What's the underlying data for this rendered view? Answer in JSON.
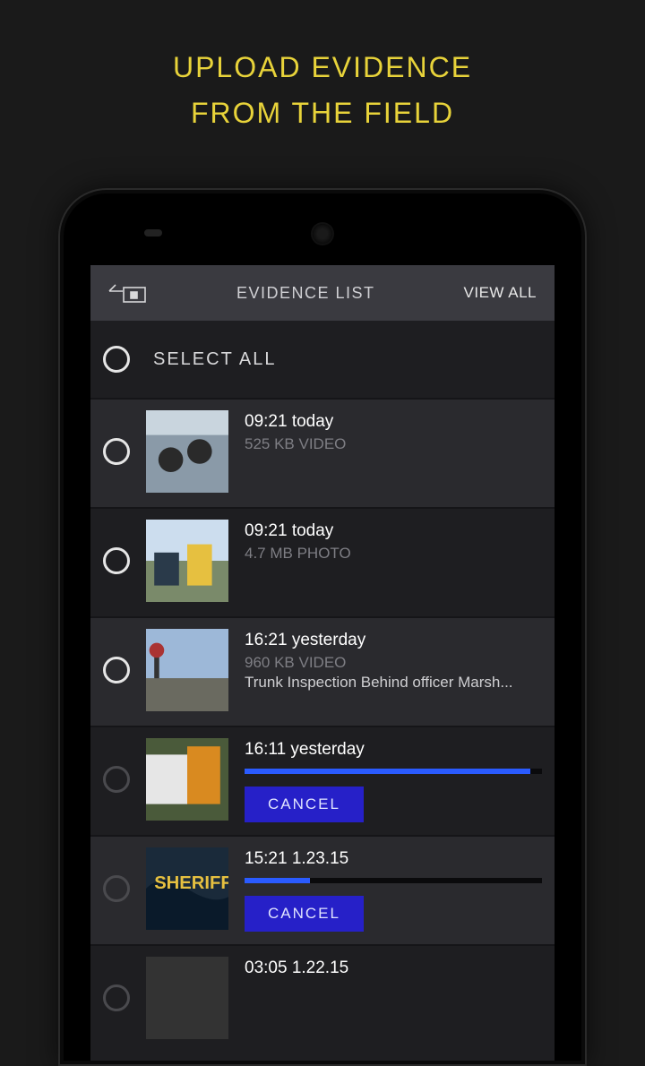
{
  "promo": {
    "line1": "UPLOAD EVIDENCE",
    "line2": "FROM THE FIELD"
  },
  "header": {
    "title": "EVIDENCE LIST",
    "view_all": "VIEW ALL"
  },
  "select_all_label": "SELECT ALL",
  "cancel_label": "CANCEL",
  "items": [
    {
      "time": "09:21 today",
      "meta": "525 KB VIDEO",
      "desc": "",
      "uploading": false,
      "progress": 0,
      "selected_dim": false,
      "alt": true
    },
    {
      "time": "09:21 today",
      "meta": "4.7 MB PHOTO",
      "desc": "",
      "uploading": false,
      "progress": 0,
      "selected_dim": false,
      "alt": false
    },
    {
      "time": "16:21 yesterday",
      "meta": "960 KB VIDEO",
      "desc": "Trunk Inspection Behind officer Marsh...",
      "uploading": false,
      "progress": 0,
      "selected_dim": false,
      "alt": true
    },
    {
      "time": "16:11 yesterday",
      "meta": "",
      "desc": "",
      "uploading": true,
      "progress": 96,
      "selected_dim": true,
      "alt": false
    },
    {
      "time": "15:21  1.23.15",
      "meta": "",
      "desc": "",
      "uploading": true,
      "progress": 22,
      "selected_dim": true,
      "alt": true
    },
    {
      "time": "03:05  1.22.15",
      "meta": "",
      "desc": "",
      "uploading": false,
      "progress": 0,
      "selected_dim": true,
      "alt": false
    }
  ]
}
